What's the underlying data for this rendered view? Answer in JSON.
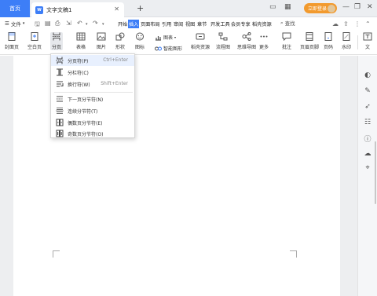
{
  "titlebar": {
    "home_tab": "首页",
    "doc_icon_text": "W",
    "doc_title": "文字文稿1",
    "login_label": "立即登录",
    "new_tab_symbol": "+"
  },
  "menubar": {
    "file_label": "文件",
    "tabs": [
      "开始",
      "插入",
      "页面布局",
      "引用",
      "审阅",
      "视图",
      "章节",
      "开发工具",
      "会员专享",
      "稻壳资源"
    ],
    "active_tab": "插入",
    "search_label": "查找"
  },
  "toolbar": {
    "items": [
      "封面页",
      "空白页",
      "分页",
      "表格",
      "图片",
      "形状",
      "图标",
      "稻壳资源",
      "流程图",
      "思维导图",
      "更多",
      "批注",
      "页眉页脚",
      "页码",
      "水印",
      "文"
    ],
    "chart_label": "图表",
    "smart_label": "智能图形"
  },
  "dropdown": {
    "items": [
      {
        "label": "分页符(P)",
        "shortcut": "Ctrl+Enter",
        "icon": "page-break-icon"
      },
      {
        "label": "分栏符(C)",
        "shortcut": "",
        "icon": "column-break-icon"
      },
      {
        "label": "换行符(W)",
        "shortcut": "Shift+Enter",
        "icon": "line-break-icon"
      },
      {
        "label": "下一页分节符(N)",
        "shortcut": "",
        "icon": "next-page-section-icon"
      },
      {
        "label": "连续分节符(T)",
        "shortcut": "",
        "icon": "continuous-section-icon"
      },
      {
        "label": "偶数页分节符(E)",
        "shortcut": "",
        "icon": "even-page-section-icon"
      },
      {
        "label": "奇数页分节符(O)",
        "shortcut": "",
        "icon": "odd-page-section-icon"
      }
    ]
  },
  "colors": {
    "accent": "#3d7ef7",
    "login": "#f29a2e",
    "canvas": "#edeef0"
  }
}
